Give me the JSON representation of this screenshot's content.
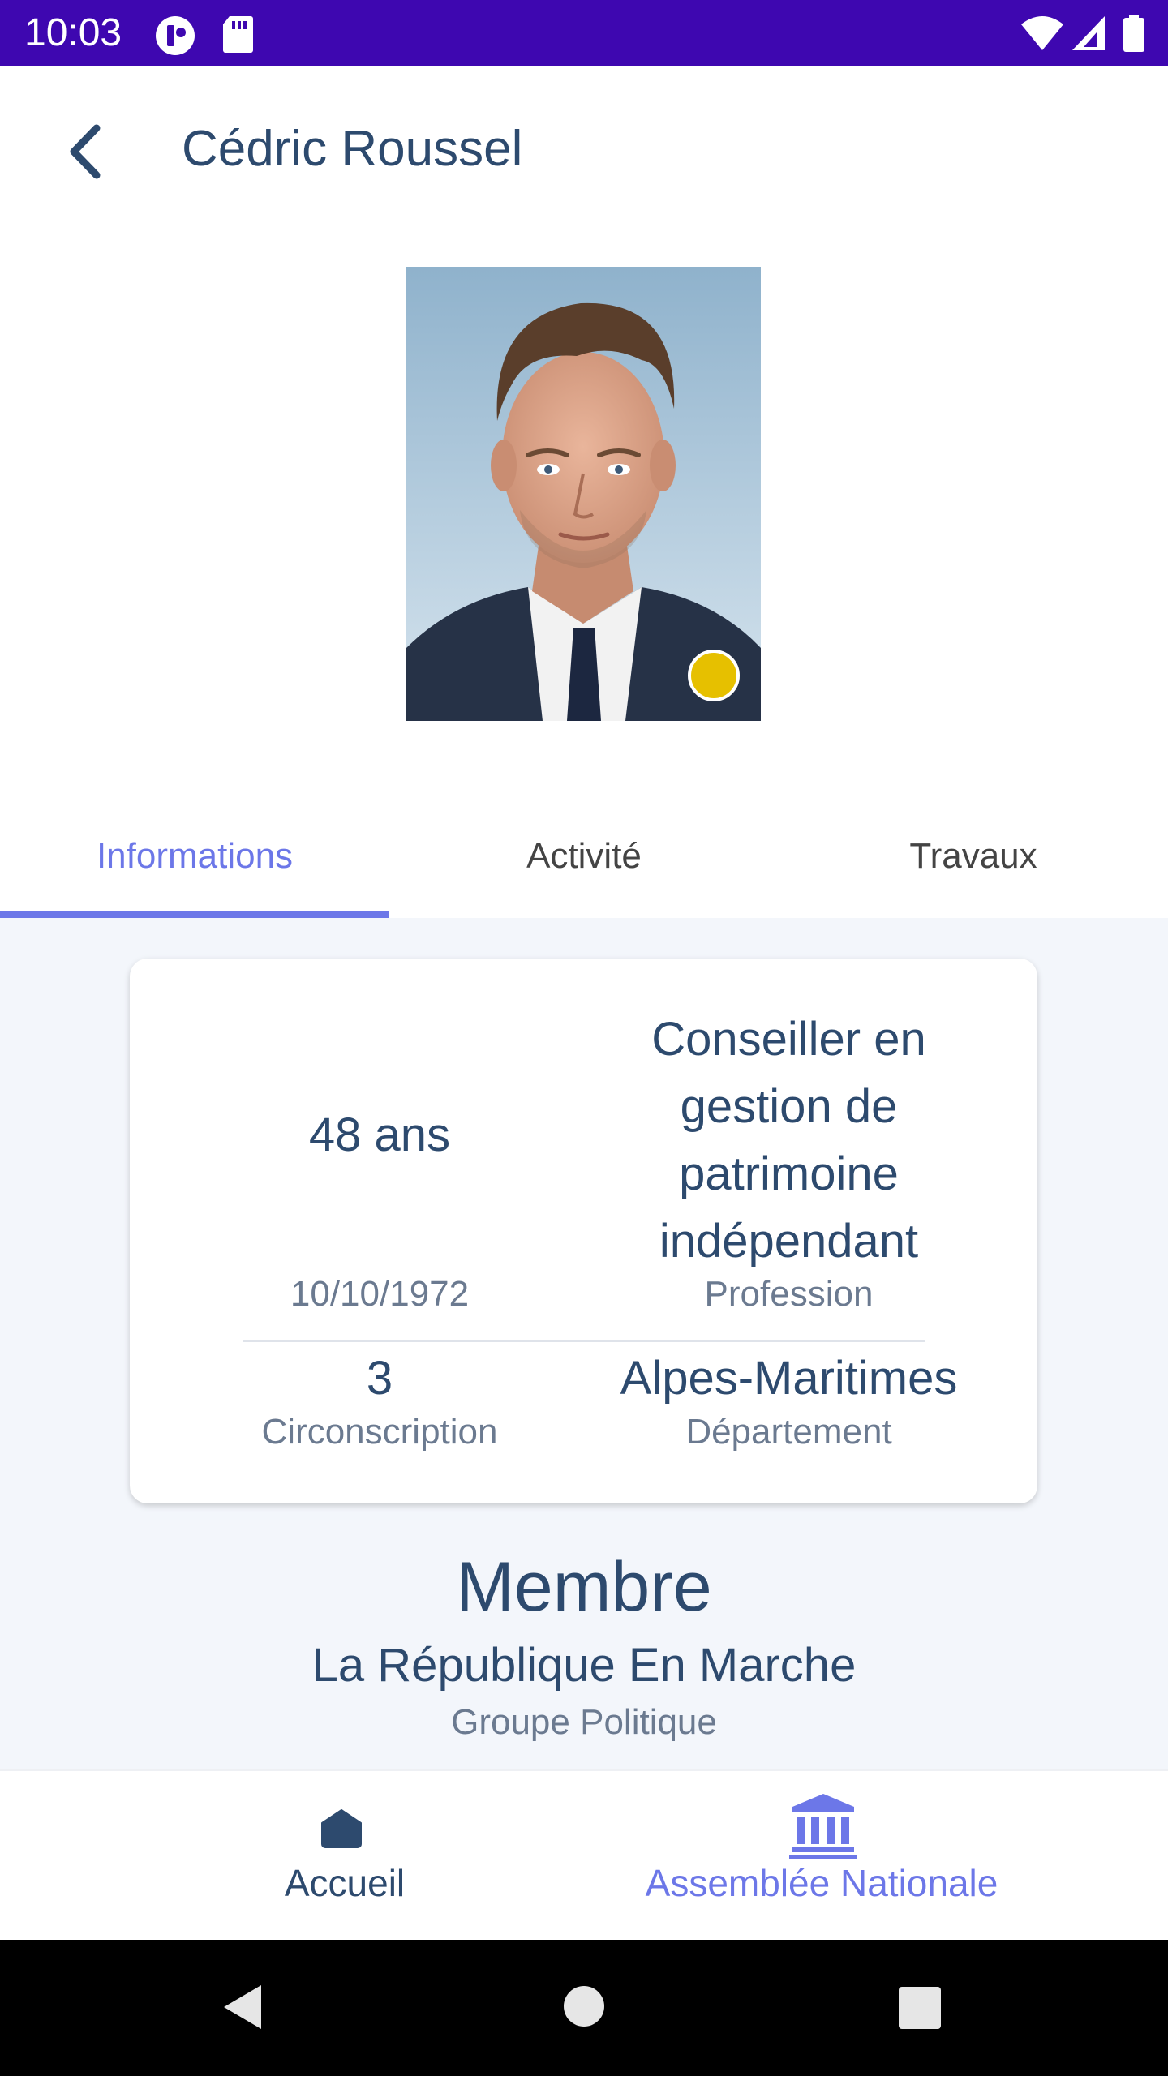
{
  "status_bar": {
    "time": "10:03",
    "icons": [
      "app-notification-icon",
      "sd-card-icon",
      "wifi-icon",
      "cell-signal-icon",
      "battery-icon"
    ]
  },
  "header": {
    "back_icon": "chevron-left-icon",
    "title": "Cédric Roussel"
  },
  "profile": {
    "photo_alt": "Portrait",
    "party_color": "#e6c000"
  },
  "tabs": [
    {
      "label": "Informations",
      "active": true
    },
    {
      "label": "Activité",
      "active": false
    },
    {
      "label": "Travaux",
      "active": false
    }
  ],
  "info_card": {
    "age": "48 ans",
    "birth_date": "10/10/1972",
    "profession_lines": [
      "Conseiller en",
      "gestion de",
      "patrimoine",
      "indépendant"
    ],
    "profession_label": "Profession",
    "circonscription": "3",
    "circonscription_label": "Circonscription",
    "departement": "Alpes-Maritimes",
    "departement_label": "Département"
  },
  "group": {
    "role": "Membre",
    "name": "La République En Marche",
    "label": "Groupe Politique"
  },
  "bottom_nav": [
    {
      "label": "Accueil",
      "icon": "home-icon",
      "active": false
    },
    {
      "label": "Assemblée Nationale",
      "icon": "institution-icon",
      "active": true
    }
  ],
  "colors": {
    "status_bar": "#3e07b0",
    "accent": "#6c77e8",
    "text_primary": "#2d4a6e",
    "text_secondary": "#6b7a90",
    "content_bg": "#f3f6fb"
  }
}
